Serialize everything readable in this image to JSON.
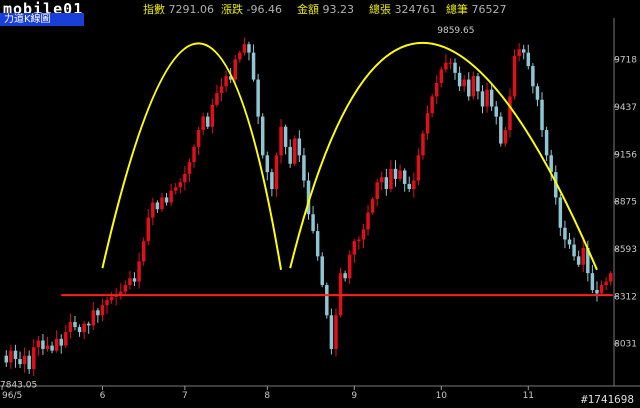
{
  "header": {
    "logo_text": "mobile01",
    "fields": [
      {
        "label": "指數",
        "value": "7291.06"
      },
      {
        "label": "漲跌",
        "value": "-96.46"
      },
      {
        "label": "金額",
        "value": "93.23"
      },
      {
        "label": "總張",
        "value": "324761"
      },
      {
        "label": "總筆",
        "value": "76527"
      }
    ],
    "tab_label": "力道K線圖"
  },
  "watermark": "#1741698",
  "colors": {
    "background": "#000000",
    "up_candle": "#e0101a",
    "down_candle": "#8fc6d4",
    "neckline": "#ff2020",
    "trend_curve": "#ffff00",
    "axis_text": "#c8c8c8"
  },
  "chart_data": {
    "type": "candlestick",
    "title": "",
    "xlabel": "",
    "ylabel": "",
    "yticks": [
      8031,
      8312,
      8593,
      8875,
      9156,
      9437,
      9718
    ],
    "xtick_labels": [
      "96/5",
      "6",
      "7",
      "8",
      "9",
      "10",
      "11"
    ],
    "ylim": [
      7780,
      9930
    ],
    "annotations": {
      "high_label": "9859.65",
      "low_label": "7843.05",
      "neckline_value": 8320
    },
    "closes": [
      7920,
      7990,
      7940,
      7910,
      7960,
      7880,
      8010,
      8050,
      8000,
      8020,
      7990,
      8060,
      8020,
      8100,
      8160,
      8130,
      8100,
      8150,
      8140,
      8230,
      8200,
      8260,
      8290,
      8310,
      8320,
      8340,
      8380,
      8420,
      8400,
      8520,
      8640,
      8780,
      8870,
      8830,
      8900,
      8870,
      8940,
      8960,
      8990,
      9040,
      9110,
      9200,
      9300,
      9380,
      9320,
      9450,
      9520,
      9560,
      9620,
      9600,
      9720,
      9760,
      9810,
      9760,
      9600,
      9380,
      9150,
      9050,
      8950,
      9150,
      9320,
      9200,
      9100,
      9250,
      9150,
      9000,
      8800,
      8700,
      8550,
      8380,
      8200,
      8000,
      8200,
      8450,
      8420,
      8560,
      8640,
      8650,
      8710,
      8810,
      8890,
      8990,
      9020,
      8950,
      9070,
      9010,
      9060,
      8980,
      8950,
      9000,
      9150,
      9280,
      9400,
      9500,
      9580,
      9660,
      9700,
      9700,
      9640,
      9560,
      9600,
      9500,
      9620,
      9530,
      9440,
      9540,
      9440,
      9380,
      9220,
      9300,
      9500,
      9740,
      9780,
      9760,
      9680,
      9560,
      9480,
      9300,
      9150,
      9050,
      8900,
      8720,
      8650,
      8620,
      8550,
      8500,
      8600,
      8450,
      8350,
      8330,
      8380,
      8400,
      8450
    ],
    "curves": [
      {
        "name": "",
        "points": [
          [
            21,
            8480
          ],
          [
            42,
            9815
          ],
          [
            60,
            8470
          ]
        ]
      },
      {
        "name": "",
        "points": [
          [
            62,
            8480
          ],
          [
            91,
            9818
          ],
          [
            129,
            8470
          ]
        ]
      }
    ]
  }
}
